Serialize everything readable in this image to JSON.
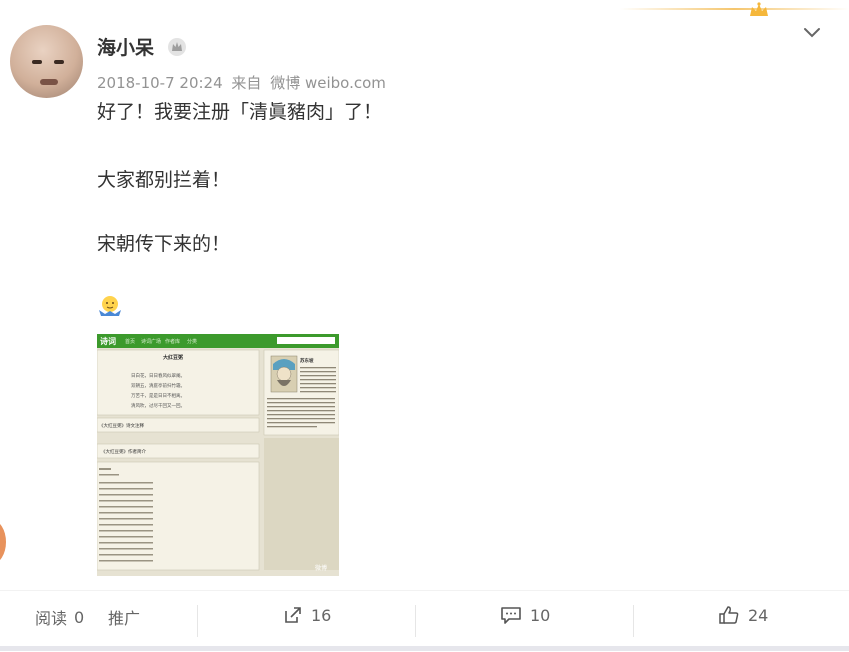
{
  "post": {
    "username": "海小呆",
    "meta": {
      "date": "2018-10-7 20:24",
      "source_prefix": "来自",
      "source": "微博 weibo.com"
    },
    "content": [
      "好了！我要注册「清眞豬肉」了！",
      "大家都别拦着！",
      "宋朝传下来的！"
    ],
    "emoji": "shrug-emoji"
  },
  "image": {
    "site_title": "诗词",
    "nav": [
      "首页",
      "诗词广场",
      "作者库",
      "分类"
    ],
    "poem_title": "大红豆粥",
    "poem_lines": [
      "日白花，日日春风似翠阑。",
      "双朝五，清庭亭前扫竹霜。",
      "万苦千，是是日日不相离。",
      "清风吹，过尽千回又一回。"
    ],
    "section1": "《大红豆粥》诗文注释",
    "section2": "《大红豆粥》作者简介",
    "author_name": "苏东坡",
    "watermark": "微博"
  },
  "footer": {
    "read_label": "阅读",
    "read_count": "0",
    "promote_label": "推广",
    "share_count": "16",
    "comment_count": "10",
    "like_count": "24"
  },
  "colors": {
    "accent": "#f5c66e",
    "meta_gray": "#939393",
    "site_green": "#3c9a2c"
  }
}
